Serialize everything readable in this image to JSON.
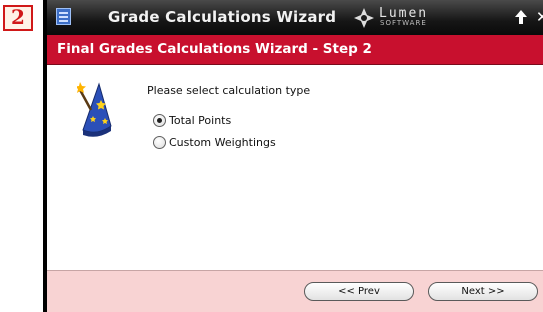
{
  "step_badge": "2",
  "window": {
    "title": "Grade Calculations Wizard",
    "brand_name": "Lumen",
    "brand_sub": "SOFTWARE",
    "close_glyph": "✕"
  },
  "header": {
    "title": "Final Grades Calculations Wizard - Step 2"
  },
  "body": {
    "prompt": "Please select calculation type",
    "options": [
      {
        "label": "Total Points",
        "checked": true
      },
      {
        "label": "Custom Weightings",
        "checked": false
      }
    ]
  },
  "footer": {
    "prev_label": "<< Prev",
    "next_label": "Next >>"
  },
  "icons": {
    "title_icon": "notepad-icon",
    "brand_icon": "lumen-logo-icon",
    "up": "arrow-up-icon",
    "close": "close-icon",
    "wizard": "wizard-hat-icon"
  },
  "colors": {
    "titlebar": "#1a1a1a",
    "header": "#c8102e",
    "footer": "#f8d3d3",
    "badge": "#d01818"
  }
}
